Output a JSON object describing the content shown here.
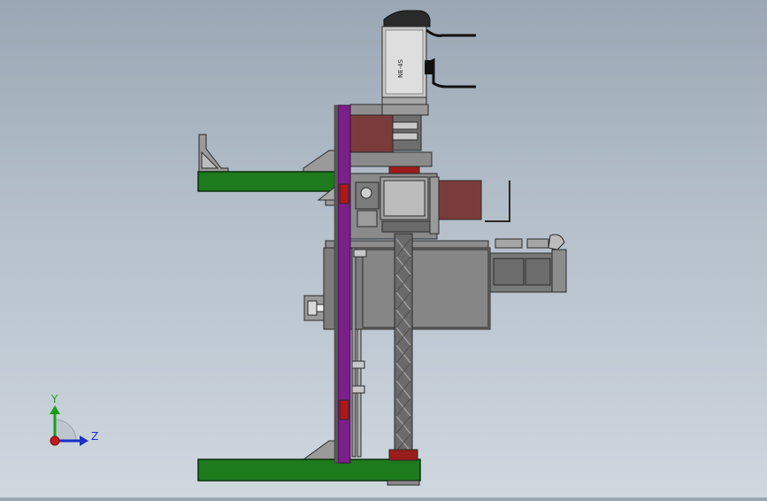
{
  "triad": {
    "y_label": "Y",
    "z_label": "Z"
  },
  "motor_label": "NE-4S",
  "colors": {
    "background_top": "#9aa7b4",
    "background_bottom": "#cfd7df",
    "green_plate": "#1d7a1d",
    "purple_column": "#7b1f8a",
    "maroon_block": "#7a3b3b",
    "red_part": "#b01818",
    "grey_body": "#7c7c7c",
    "axis_y": "#1a9e1a",
    "axis_z": "#1a30c8",
    "axis_x": "#c81a1a"
  }
}
